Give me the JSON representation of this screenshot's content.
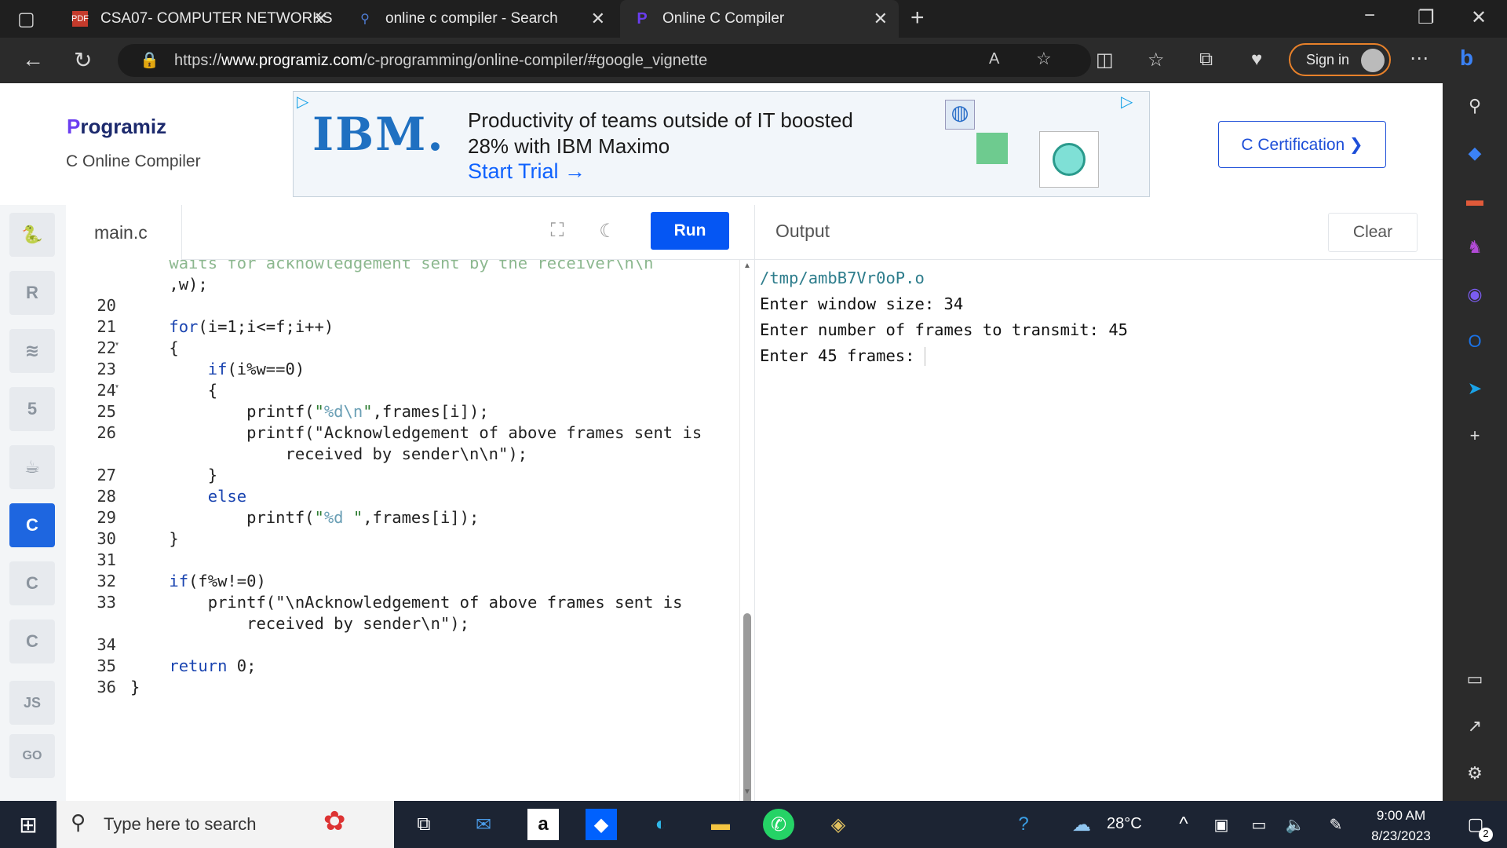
{
  "browser": {
    "tabs": [
      {
        "label": "CSA07- COMPUTER NETWORKS",
        "icon": "pdf-icon"
      },
      {
        "label": "online c compiler - Search",
        "icon": "search-icon"
      },
      {
        "label": "Online C Compiler",
        "icon": "programiz-icon"
      }
    ],
    "url_prefix": "https://",
    "url_domain": "www.programiz.com",
    "url_path": "/c-programming/online-compiler/#google_vignette",
    "signin_label": "Sign in"
  },
  "site": {
    "logo_text": "rogramiz",
    "logo_letter": "P",
    "subtitle": "C Online Compiler",
    "certification_label": "C Certification ❯"
  },
  "ad": {
    "brand": "IBM.",
    "headline": "Productivity of teams outside of IT boosted 28% with IBM Maximo",
    "cta": "Start Trial →"
  },
  "editor": {
    "file_name": "main.c",
    "run_label": "Run",
    "lines": [
      {
        "n": "",
        "html": "    <span class='src-faded'>waits for acknowledgement sent by the receiver\\n\\n</span>"
      },
      {
        "n": "",
        "text": "    ,w);"
      },
      {
        "n": "20",
        "text": ""
      },
      {
        "n": "21",
        "text": "    for(i=1;i<=f;i++)"
      },
      {
        "n": "22",
        "text": "    {",
        "fold": true
      },
      {
        "n": "23",
        "text": "        if(i%w==0)"
      },
      {
        "n": "24",
        "text": "        {",
        "fold": true
      },
      {
        "n": "25",
        "text": "            printf(\"%d\\n\",frames[i]);"
      },
      {
        "n": "26",
        "text": "            printf(\"Acknowledgement of above frames sent is"
      },
      {
        "n": "",
        "text": "                received by sender\\n\\n\");"
      },
      {
        "n": "27",
        "text": "        }"
      },
      {
        "n": "28",
        "text": "        else"
      },
      {
        "n": "29",
        "text": "            printf(\"%d \",frames[i]);"
      },
      {
        "n": "30",
        "text": "    }"
      },
      {
        "n": "31",
        "text": ""
      },
      {
        "n": "32",
        "text": "    if(f%w!=0)"
      },
      {
        "n": "33",
        "text": "        printf(\"\\nAcknowledgement of above frames sent is"
      },
      {
        "n": "",
        "text": "            received by sender\\n\");"
      },
      {
        "n": "34",
        "text": ""
      },
      {
        "n": "35",
        "text": "    return 0;"
      },
      {
        "n": "36",
        "text": "}"
      }
    ]
  },
  "output": {
    "title": "Output",
    "clear_label": "Clear",
    "lines": [
      "/tmp/ambB7Vr0oP.o",
      "Enter window size: 34",
      "Enter number of frames to transmit: 45",
      "Enter 45 frames: "
    ]
  },
  "sidebar_langs": [
    "python",
    "r",
    "sql",
    "html",
    "java",
    "c",
    "cpp",
    "csharp",
    "js",
    "go"
  ],
  "taskbar": {
    "search_placeholder": "Type here to search",
    "weather": "28°C",
    "time": "9:00 AM",
    "date": "8/23/2023",
    "notifications": "2"
  }
}
